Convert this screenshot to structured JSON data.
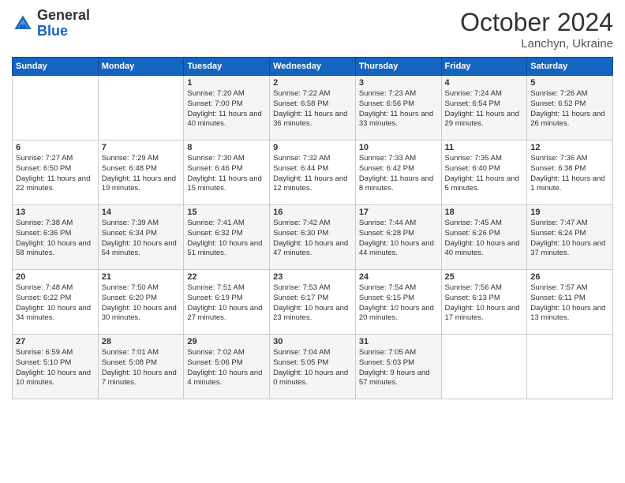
{
  "header": {
    "logo": {
      "general": "General",
      "blue": "Blue"
    },
    "title": "October 2024",
    "subtitle": "Lanchyn, Ukraine"
  },
  "weekdays": [
    "Sunday",
    "Monday",
    "Tuesday",
    "Wednesday",
    "Thursday",
    "Friday",
    "Saturday"
  ],
  "weeks": [
    [
      {
        "day": "",
        "info": ""
      },
      {
        "day": "",
        "info": ""
      },
      {
        "day": "1",
        "info": "Sunrise: 7:20 AM\nSunset: 7:00 PM\nDaylight: 11 hours and 40 minutes."
      },
      {
        "day": "2",
        "info": "Sunrise: 7:22 AM\nSunset: 6:58 PM\nDaylight: 11 hours and 36 minutes."
      },
      {
        "day": "3",
        "info": "Sunrise: 7:23 AM\nSunset: 6:56 PM\nDaylight: 11 hours and 33 minutes."
      },
      {
        "day": "4",
        "info": "Sunrise: 7:24 AM\nSunset: 6:54 PM\nDaylight: 11 hours and 29 minutes."
      },
      {
        "day": "5",
        "info": "Sunrise: 7:26 AM\nSunset: 6:52 PM\nDaylight: 11 hours and 26 minutes."
      }
    ],
    [
      {
        "day": "6",
        "info": "Sunrise: 7:27 AM\nSunset: 6:50 PM\nDaylight: 11 hours and 22 minutes."
      },
      {
        "day": "7",
        "info": "Sunrise: 7:29 AM\nSunset: 6:48 PM\nDaylight: 11 hours and 19 minutes."
      },
      {
        "day": "8",
        "info": "Sunrise: 7:30 AM\nSunset: 6:46 PM\nDaylight: 11 hours and 15 minutes."
      },
      {
        "day": "9",
        "info": "Sunrise: 7:32 AM\nSunset: 6:44 PM\nDaylight: 11 hours and 12 minutes."
      },
      {
        "day": "10",
        "info": "Sunrise: 7:33 AM\nSunset: 6:42 PM\nDaylight: 11 hours and 8 minutes."
      },
      {
        "day": "11",
        "info": "Sunrise: 7:35 AM\nSunset: 6:40 PM\nDaylight: 11 hours and 5 minutes."
      },
      {
        "day": "12",
        "info": "Sunrise: 7:36 AM\nSunset: 6:38 PM\nDaylight: 11 hours and 1 minute."
      }
    ],
    [
      {
        "day": "13",
        "info": "Sunrise: 7:38 AM\nSunset: 6:36 PM\nDaylight: 10 hours and 58 minutes."
      },
      {
        "day": "14",
        "info": "Sunrise: 7:39 AM\nSunset: 6:34 PM\nDaylight: 10 hours and 54 minutes."
      },
      {
        "day": "15",
        "info": "Sunrise: 7:41 AM\nSunset: 6:32 PM\nDaylight: 10 hours and 51 minutes."
      },
      {
        "day": "16",
        "info": "Sunrise: 7:42 AM\nSunset: 6:30 PM\nDaylight: 10 hours and 47 minutes."
      },
      {
        "day": "17",
        "info": "Sunrise: 7:44 AM\nSunset: 6:28 PM\nDaylight: 10 hours and 44 minutes."
      },
      {
        "day": "18",
        "info": "Sunrise: 7:45 AM\nSunset: 6:26 PM\nDaylight: 10 hours and 40 minutes."
      },
      {
        "day": "19",
        "info": "Sunrise: 7:47 AM\nSunset: 6:24 PM\nDaylight: 10 hours and 37 minutes."
      }
    ],
    [
      {
        "day": "20",
        "info": "Sunrise: 7:48 AM\nSunset: 6:22 PM\nDaylight: 10 hours and 34 minutes."
      },
      {
        "day": "21",
        "info": "Sunrise: 7:50 AM\nSunset: 6:20 PM\nDaylight: 10 hours and 30 minutes."
      },
      {
        "day": "22",
        "info": "Sunrise: 7:51 AM\nSunset: 6:19 PM\nDaylight: 10 hours and 27 minutes."
      },
      {
        "day": "23",
        "info": "Sunrise: 7:53 AM\nSunset: 6:17 PM\nDaylight: 10 hours and 23 minutes."
      },
      {
        "day": "24",
        "info": "Sunrise: 7:54 AM\nSunset: 6:15 PM\nDaylight: 10 hours and 20 minutes."
      },
      {
        "day": "25",
        "info": "Sunrise: 7:56 AM\nSunset: 6:13 PM\nDaylight: 10 hours and 17 minutes."
      },
      {
        "day": "26",
        "info": "Sunrise: 7:57 AM\nSunset: 6:11 PM\nDaylight: 10 hours and 13 minutes."
      }
    ],
    [
      {
        "day": "27",
        "info": "Sunrise: 6:59 AM\nSunset: 5:10 PM\nDaylight: 10 hours and 10 minutes."
      },
      {
        "day": "28",
        "info": "Sunrise: 7:01 AM\nSunset: 5:08 PM\nDaylight: 10 hours and 7 minutes."
      },
      {
        "day": "29",
        "info": "Sunrise: 7:02 AM\nSunset: 5:06 PM\nDaylight: 10 hours and 4 minutes."
      },
      {
        "day": "30",
        "info": "Sunrise: 7:04 AM\nSunset: 5:05 PM\nDaylight: 10 hours and 0 minutes."
      },
      {
        "day": "31",
        "info": "Sunrise: 7:05 AM\nSunset: 5:03 PM\nDaylight: 9 hours and 57 minutes."
      },
      {
        "day": "",
        "info": ""
      },
      {
        "day": "",
        "info": ""
      }
    ]
  ]
}
